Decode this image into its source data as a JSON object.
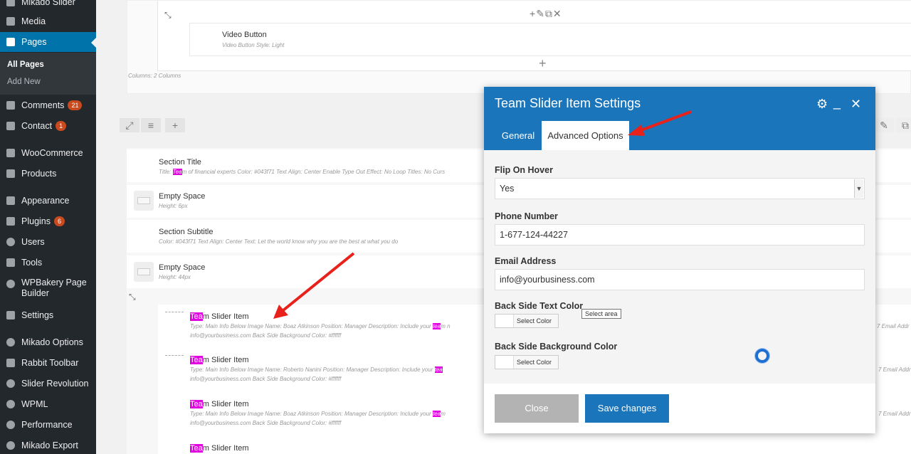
{
  "sidebar": {
    "items": [
      {
        "label": "Mikado Slider",
        "icon": "slider-icon"
      },
      {
        "label": "Media",
        "icon": "media-icon"
      },
      {
        "label": "Pages",
        "icon": "pages-icon"
      },
      {
        "label": "Comments",
        "icon": "comments-icon",
        "badge": "21"
      },
      {
        "label": "Contact",
        "icon": "mail-icon",
        "badge": "1"
      },
      {
        "label": "WooCommerce",
        "icon": "woocommerce-icon"
      },
      {
        "label": "Products",
        "icon": "products-icon"
      },
      {
        "label": "Appearance",
        "icon": "appearance-icon"
      },
      {
        "label": "Plugins",
        "icon": "plugins-icon",
        "badge": "6"
      },
      {
        "label": "Users",
        "icon": "users-icon"
      },
      {
        "label": "Tools",
        "icon": "tools-icon"
      },
      {
        "label": "WPBakery Page Builder",
        "icon": "wpbakery-icon"
      },
      {
        "label": "Settings",
        "icon": "settings-icon"
      },
      {
        "label": "Mikado Options",
        "icon": "mikado-options-icon"
      },
      {
        "label": "Rabbit Toolbar",
        "icon": "rabbit-toolbar-icon"
      },
      {
        "label": "Slider Revolution",
        "icon": "slider-revolution-icon"
      },
      {
        "label": "WPML",
        "icon": "wpml-icon"
      },
      {
        "label": "Performance",
        "icon": "performance-icon"
      },
      {
        "label": "Mikado Export",
        "icon": "mikado-export-icon"
      }
    ],
    "submenu": [
      "All Pages",
      "Add New"
    ]
  },
  "builder": {
    "video_button_title": "Video Button",
    "video_button_desc": "Video Button Style: Light",
    "columns_label": "Columns: 2 Columns",
    "section_title": {
      "title": "Section Title",
      "desc_pre": "Title: ",
      "desc_hl": "Tea",
      "desc_post": "m of financial experts  Color: #043f71  Text Align: Center  Enable Type Out Effect: No  Loop Titles: No  Curs"
    },
    "empty_space_1": {
      "title": "Empty Space",
      "desc": "Height: 6px"
    },
    "section_subtitle": {
      "title": "Section Subtitle",
      "desc": "Color: #043f71  Text Align: Center  Text: Let the world know why you are the best at what you do"
    },
    "empty_space_2": {
      "title": "Empty Space",
      "desc": "Height: 44px"
    },
    "team_items": [
      {
        "title_hl": "Tea",
        "title_rest": "m Slider Item",
        "line1_pre": "Type: Main Info Below Image  Name: Boaz Atkinson  Position: Manager  Description: Include your ",
        "line1_hl": "tea",
        "line1_post": "m n",
        "line1_right": "7  Email Addr",
        "line2": "info@yourbusiness.com  Back Side Background Color: #ffffff"
      },
      {
        "title_hl": "Tea",
        "title_rest": "m Slider Item",
        "line1_pre": "Type: Main Info Below Image  Name: Roberto Nanini  Position: Manager  Description: Include your ",
        "line1_hl": "tea",
        "line1_post": "",
        "line1_right": "7  Email Addr",
        "line2": "info@yourbusiness.com  Back Side Background Color: #ffffff"
      },
      {
        "title_hl": "Tea",
        "title_rest": "m Slider Item",
        "line1_pre": "Type: Main Info Below Image  Name: Boaz Atkinson  Position: Manager  Description: Include your ",
        "line1_hl": "tea",
        "line1_post": "m",
        "line1_right": "7  Email Addr",
        "line2": "info@yourbusiness.com  Back Side Background Color: #ffffff"
      },
      {
        "title_hl": "Tea",
        "title_rest": "m Slider Item"
      }
    ]
  },
  "modal": {
    "title": "Team Slider Item Settings",
    "tabs": [
      "General",
      "Advanced Options"
    ],
    "fields": {
      "flip_label": "Flip On Hover",
      "flip_value": "Yes",
      "phone_label": "Phone Number",
      "phone_value": "1-677-124-44227",
      "email_label": "Email Address",
      "email_value": "info@yourbusiness.com",
      "back_text_color_label": "Back Side Text Color",
      "back_bg_color_label": "Back Side Background Color",
      "select_color": "Select Color",
      "tooltip": "Select area"
    },
    "buttons": {
      "close": "Close",
      "save": "Save changes"
    }
  },
  "colors": {
    "sidebar_bg": "#23282d",
    "active_blue": "#0073aa",
    "modal_header": "#1b75bb",
    "highlight": "#e000e0",
    "arrow_red": "#e8211a"
  }
}
